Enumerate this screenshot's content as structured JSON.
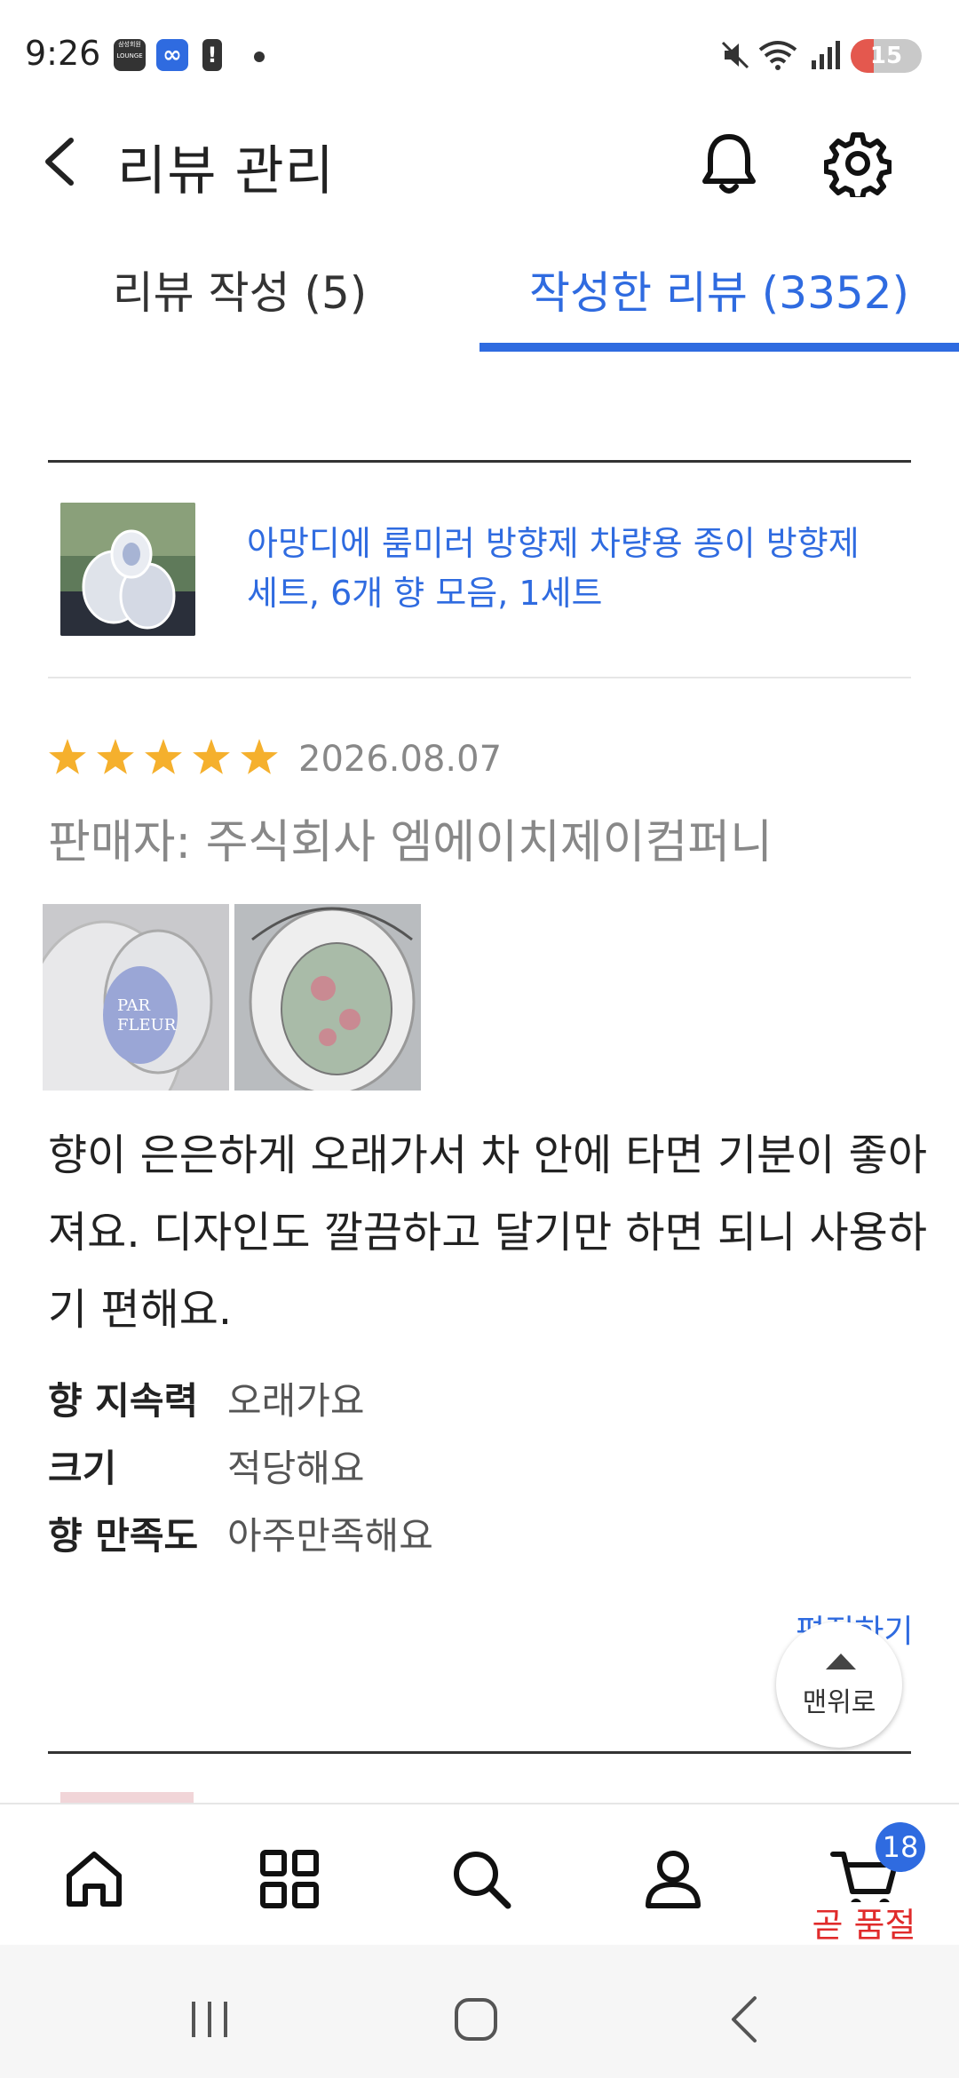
{
  "status": {
    "time": "9:26",
    "lounge_label": "삼성회원 LOUNGE",
    "battery": "15"
  },
  "header": {
    "title": "리뷰 관리"
  },
  "tabs": [
    {
      "label": "리뷰 작성 (5)"
    },
    {
      "label": "작성한 리뷰 (3352)"
    }
  ],
  "product": {
    "name": "아망디에 룸미러 방향제 차량용 종이 방향제 세트, 6개 향 모음, 1세트"
  },
  "review": {
    "rating": 5,
    "date": "2026.08.07",
    "seller": "판매자: 주식회사 엠에이치제이컴퍼니",
    "text": "향이 은은하게 오래가서 차 안에 타면 기분이 좋아져요. 디자인도 깔끔하고 달기만 하면 되니 사용하기 편해요.",
    "attributes": [
      {
        "key": "향 지속력",
        "value": "오래가요"
      },
      {
        "key": "크기",
        "value": "적당해요"
      },
      {
        "key": "향 만족도",
        "value": "아주만족해요"
      }
    ],
    "edit_label": "편집하기"
  },
  "scroll_top": {
    "label": "맨위로"
  },
  "bottom_nav": {
    "cart_count": "18",
    "cart_notice": "곧 품절"
  },
  "colors": {
    "accent": "#2f6be0",
    "star": "#f5b02d",
    "notice": "#e02b2b"
  }
}
